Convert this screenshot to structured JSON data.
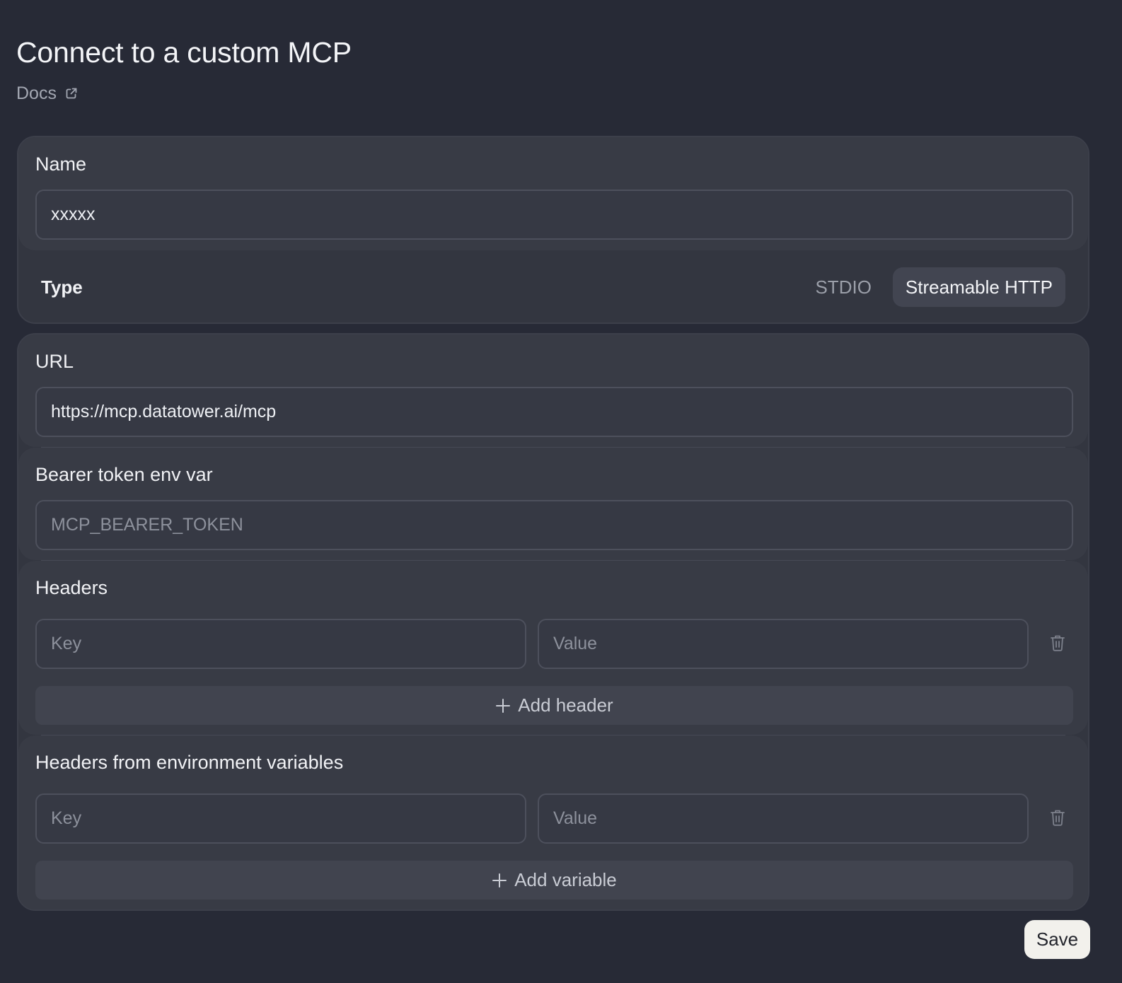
{
  "page": {
    "title": "Connect to a custom MCP",
    "docs_label": "Docs"
  },
  "name_section": {
    "label": "Name",
    "value": "xxxxx"
  },
  "type_section": {
    "label": "Type",
    "options": [
      "STDIO",
      "Streamable HTTP"
    ],
    "selected": "Streamable HTTP"
  },
  "url_section": {
    "label": "URL",
    "value": "https://mcp.datatower.ai/mcp"
  },
  "bearer_section": {
    "label": "Bearer token env var",
    "placeholder": "MCP_BEARER_TOKEN"
  },
  "headers_section": {
    "label": "Headers",
    "key_placeholder": "Key",
    "value_placeholder": "Value",
    "add_label": "Add header"
  },
  "env_headers_section": {
    "label": "Headers from environment variables",
    "key_placeholder": "Key",
    "value_placeholder": "Value",
    "add_label": "Add variable"
  },
  "footer": {
    "save_label": "Save"
  },
  "icons": {
    "docs": "external-link-icon",
    "delete": "trash-icon",
    "add": "plus-icon"
  }
}
